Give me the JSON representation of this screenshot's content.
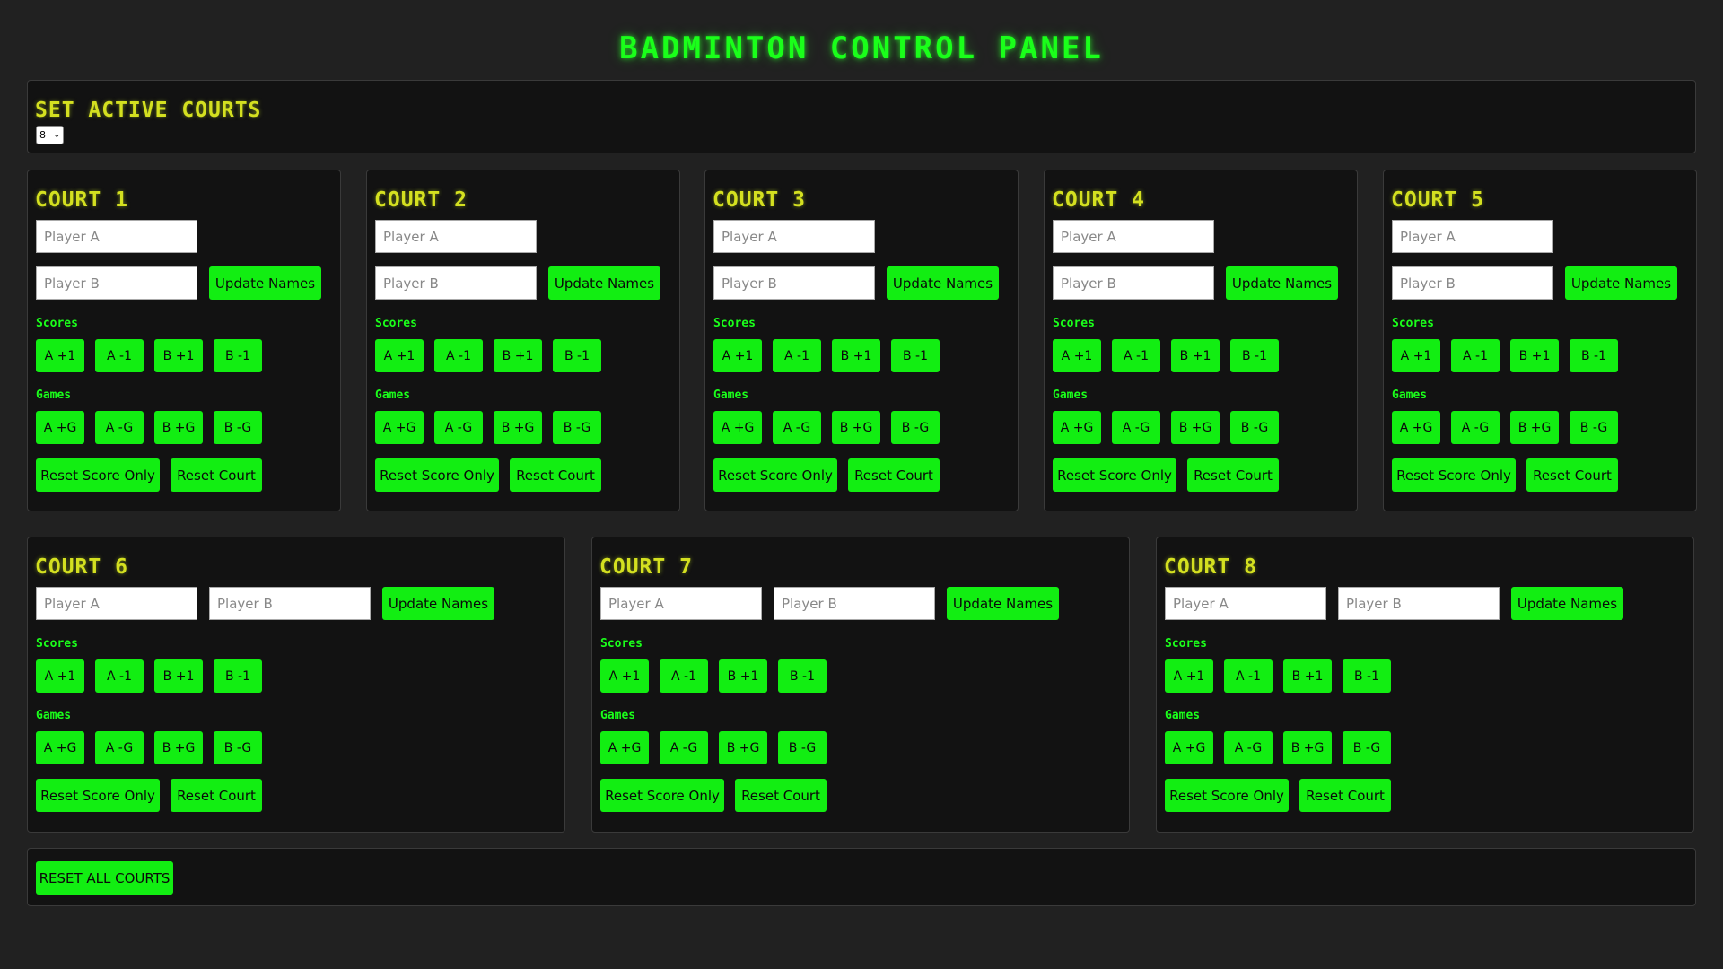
{
  "title": "BADMINTON CONTROL PANEL",
  "active_courts": {
    "heading": "SET ACTIVE COURTS",
    "selected": "8"
  },
  "labels": {
    "player_a_placeholder": "Player A",
    "player_b_placeholder": "Player B",
    "update_names": "Update Names",
    "scores": "Scores",
    "games": "Games",
    "a_plus_1": "A +1",
    "a_minus_1": "A -1",
    "b_plus_1": "B +1",
    "b_minus_1": "B -1",
    "a_plus_g": "A +G",
    "a_minus_g": "A -G",
    "b_plus_g": "B +G",
    "b_minus_g": "B -G",
    "reset_score_only": "Reset Score Only",
    "reset_court": "Reset Court"
  },
  "courts": [
    {
      "name": "COURT 1"
    },
    {
      "name": "COURT 2"
    },
    {
      "name": "COURT 3"
    },
    {
      "name": "COURT 4"
    },
    {
      "name": "COURT 5"
    },
    {
      "name": "COURT 6"
    },
    {
      "name": "COURT 7"
    },
    {
      "name": "COURT 8"
    }
  ],
  "reset_all_label": "RESET ALL COURTS",
  "colors": {
    "accent_green": "#12ee12",
    "heading_yellow": "#d4e020",
    "background": "#212121",
    "panel": "#121212"
  }
}
